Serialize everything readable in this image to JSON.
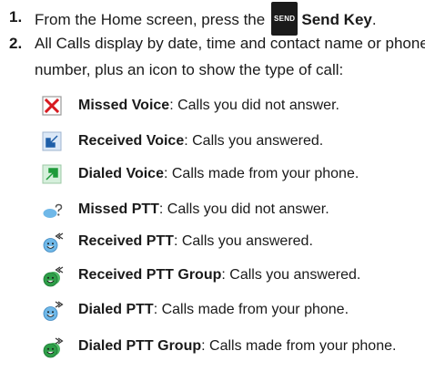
{
  "steps": [
    {
      "num": "1.",
      "pre": "From the Home screen, press the",
      "key": "SEND",
      "bold": "Send Key",
      "post": "."
    },
    {
      "num": "2.",
      "line1": "All Calls display by date, time and contact name or phone",
      "line2": "number, plus an icon to show the type of call:"
    }
  ],
  "call_types": [
    {
      "icon": "missed-voice-icon",
      "name": "Missed Voice",
      "desc": ": Calls you did not answer."
    },
    {
      "icon": "received-voice-icon",
      "name": "Received Voice",
      "desc": ": Calls you answered."
    },
    {
      "icon": "dialed-voice-icon",
      "name": "Dialed Voice",
      "desc": ": Calls made from your phone."
    },
    {
      "icon": "missed-ptt-icon",
      "name": "Missed PTT",
      "desc": ": Calls you did not answer."
    },
    {
      "icon": "received-ptt-icon",
      "name": "Received PTT",
      "desc": ": Calls you answered."
    },
    {
      "icon": "received-ptt-group-icon",
      "name": "Received PTT Group",
      "desc": ": Calls you answered."
    },
    {
      "icon": "dialed-ptt-icon",
      "name": "Dialed PTT",
      "desc": ": Calls made from your phone."
    },
    {
      "icon": "dialed-ptt-group-icon",
      "name": "Dialed PTT Group",
      "desc": ": Calls made from your phone."
    }
  ],
  "colors": {
    "missed": "#d71920",
    "received": "#1f5fa8",
    "dialed": "#1e9a3a",
    "ptt_face": "#6fb8e8",
    "ptt_group": "#2e9e48"
  }
}
